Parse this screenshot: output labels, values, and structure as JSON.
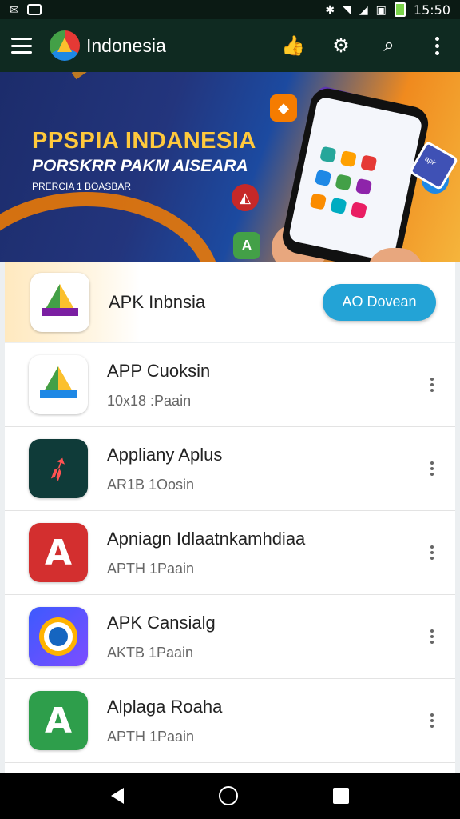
{
  "status_bar": {
    "time": "15:50",
    "icons": [
      "gmail-icon",
      "notification-icon",
      "bluetooth-icon",
      "wifi-icon",
      "signal-icon",
      "nfc-icon",
      "battery-icon"
    ]
  },
  "app_bar": {
    "title": "Indonesia",
    "actions": [
      "thumbs-up-icon",
      "settings-icon",
      "search-icon",
      "more-vert-icon"
    ]
  },
  "banner": {
    "line1": "PPSPIA INDANESIA",
    "line2": "PORSKRR PAKM AISEARA",
    "line3": "PRERCIA 1 BOASBAR",
    "cube_text": "apk"
  },
  "featured": {
    "name": "APK Inbnsia",
    "button_label": "AO Dovean"
  },
  "apps": [
    {
      "title": "APP Cuoksin",
      "subtitle": "10x18 :Paain",
      "icon": "drive-icon"
    },
    {
      "title": "Appliany Aplus",
      "subtitle": "AR1B 1Oosin",
      "icon": "swift-icon"
    },
    {
      "title": "Apniagn Idlaatnkamhdiaa",
      "subtitle": "APTH 1Paain",
      "icon": "letter-a-red-icon"
    },
    {
      "title": "APK Cansialg",
      "subtitle": "AKTB 1Paain",
      "icon": "gear-app-icon"
    },
    {
      "title": "Alplaga Roaha",
      "subtitle": "APTH 1Paain",
      "icon": "letter-a-green-icon"
    }
  ],
  "colors": {
    "app_bar": "#0f2a21",
    "accent_button": "#23a3d6",
    "nav_bar": "#000000"
  }
}
